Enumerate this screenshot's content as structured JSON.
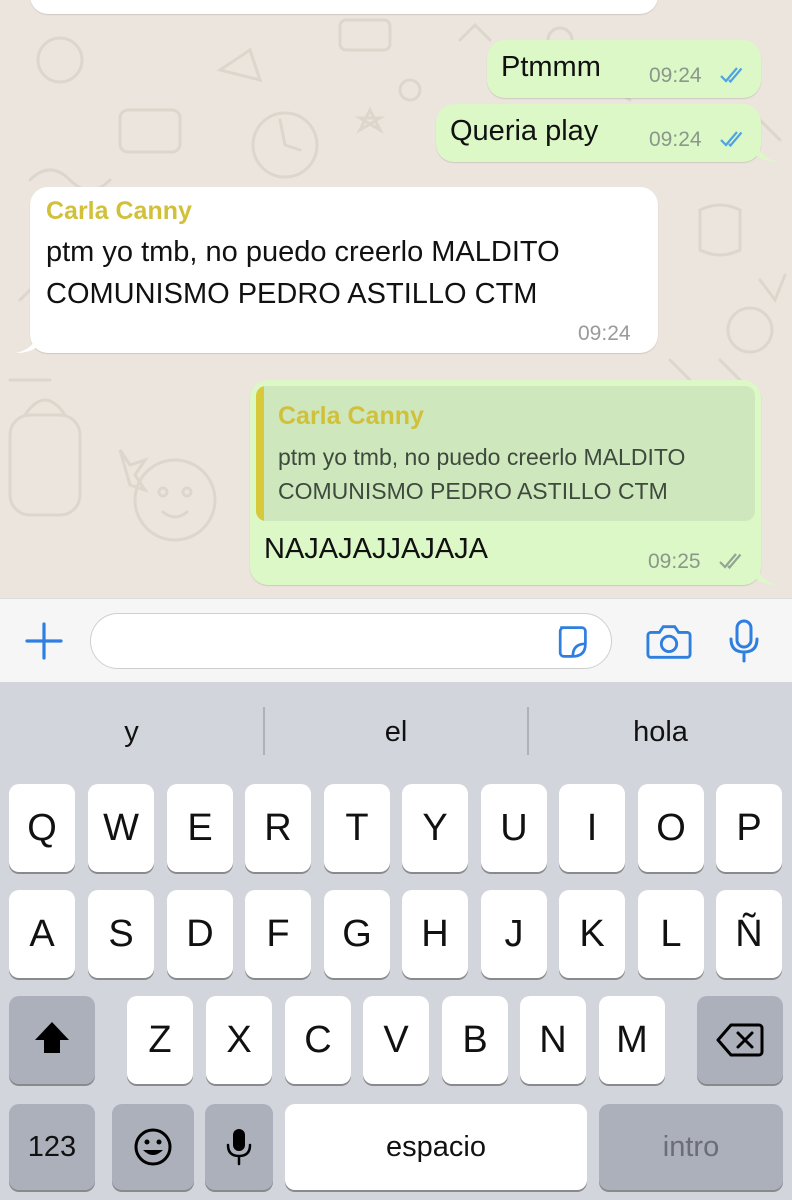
{
  "messages": [
    {
      "text": "Ptmmm",
      "time": "09:24"
    },
    {
      "text": "Queria play",
      "time": "09:24"
    },
    {
      "sender": "Carla Canny",
      "line1": "ptm yo tmb, no puedo creerlo MALDITO",
      "line2": "COMUNISMO PEDRO ASTILLO CTM",
      "time": "09:24"
    },
    {
      "quote_sender": "Carla Canny",
      "quote_line1": "ptm yo tmb, no puedo creerlo MALDITO",
      "quote_line2": "COMUNISMO PEDRO ASTILLO CTM",
      "text": "NAJAJAJJAJAJA",
      "time": "09:25"
    }
  ],
  "composer": {
    "placeholder": ""
  },
  "icons": [
    "plus-icon",
    "sticker-icon",
    "camera-icon",
    "microphone-icon",
    "shift-icon",
    "backspace-icon",
    "emoji-icon",
    "dictation-icon",
    "double-check-icon"
  ],
  "colors": {
    "accent": "#2f7fe0",
    "outgoing": "#dcf8c6",
    "incoming": "#ffffff",
    "sender": "#d1c13a",
    "read_ticks": "#4fa3e0",
    "delivered_ticks": "#92a592"
  },
  "keyboard": {
    "suggestions": [
      "y",
      "el",
      "hola"
    ],
    "row1": [
      "Q",
      "W",
      "E",
      "R",
      "T",
      "Y",
      "U",
      "I",
      "O",
      "P"
    ],
    "row2": [
      "A",
      "S",
      "D",
      "F",
      "G",
      "H",
      "J",
      "K",
      "L",
      "Ñ"
    ],
    "row3": [
      "Z",
      "X",
      "C",
      "V",
      "B",
      "N",
      "M"
    ],
    "numbers_label": "123",
    "space_label": "espacio",
    "return_label": "intro"
  }
}
